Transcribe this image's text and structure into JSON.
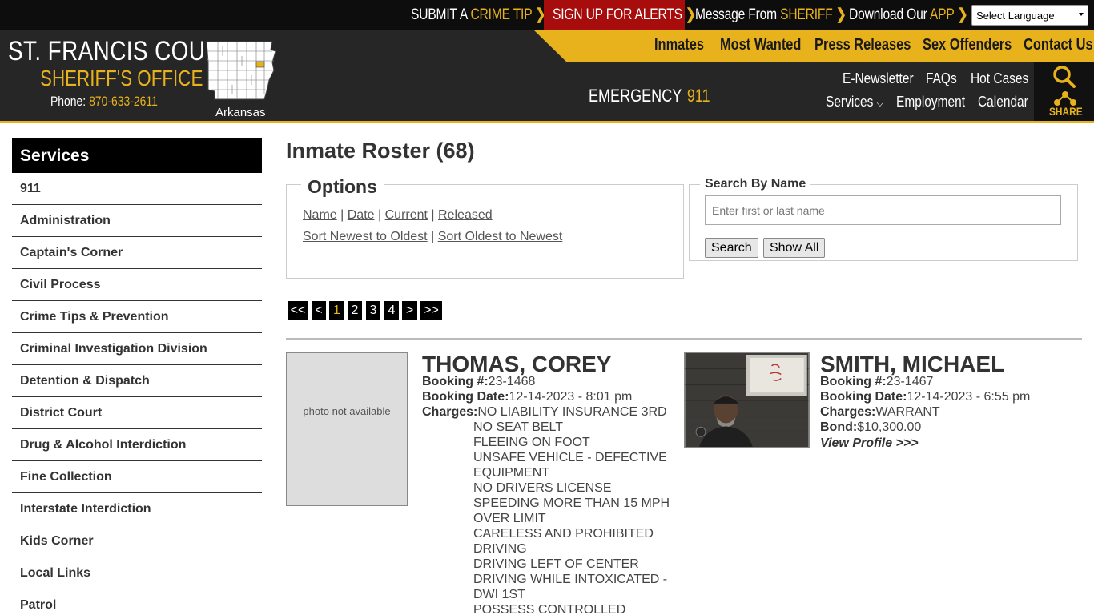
{
  "topbar": {
    "crime_tip": {
      "prefix": "SUBMIT A ",
      "highlight": "CRIME TIP"
    },
    "alerts": "SIGN UP FOR ALERTS",
    "sheriff": {
      "prefix": "Message From ",
      "highlight": "SHERIFF"
    },
    "app": {
      "prefix": "Download Our ",
      "highlight": "APP"
    },
    "language": "Select Language"
  },
  "brand": {
    "county": "ST. FRANCIS COUNTY",
    "office": "SHERIFF'S OFFICE",
    "phone_label": "Phone:",
    "phone": "870-633-2611",
    "state": "Arkansas"
  },
  "main_nav": [
    "Inmates",
    "Most Wanted",
    "Press Releases",
    "Sex Offenders",
    "Contact Us"
  ],
  "emergency": {
    "label": "EMERGENCY",
    "number": "911"
  },
  "sub_nav": {
    "enewsletter": "E-Newsletter",
    "faqs": "FAQs",
    "hot_cases": "Hot Cases",
    "services": "Services",
    "employment": "Employment",
    "calendar": "Calendar",
    "share": "SHARE"
  },
  "sidebar": {
    "title": "Services",
    "items": [
      "911",
      "Administration",
      "Captain's Corner",
      "Civil Process",
      "Crime Tips & Prevention",
      "Criminal Investigation Division",
      "Detention & Dispatch",
      "District Court",
      "Drug & Alcohol Interdiction",
      "Fine Collection",
      "Interstate Interdiction",
      "Kids Corner",
      "Local Links",
      "Patrol"
    ]
  },
  "page": {
    "title": "Inmate Roster (68)",
    "options": {
      "legend": "Options",
      "sort_name": "Name",
      "sort_date": "Date",
      "filter_current": "Current",
      "filter_released": "Released",
      "sort_newest": "Sort Newest to Oldest",
      "sort_oldest": "Sort Oldest to Newest",
      "sep": "|"
    },
    "search": {
      "legend": "Search By Name",
      "placeholder": "Enter first or last name",
      "search_btn": "Search",
      "show_all_btn": "Show All"
    },
    "pagination": {
      "first": "<<",
      "prev": "<",
      "pages": [
        "1",
        "2",
        "3",
        "4"
      ],
      "next": ">",
      "last": ">>",
      "current": "1"
    }
  },
  "inmates": [
    {
      "name": "THOMAS, COREY",
      "photo_text": "photo not available",
      "booking_label": "Booking #:",
      "booking": "23-1468",
      "date_label": "Booking Date:",
      "date": "12-14-2023 - 8:01 pm",
      "charges_label": "Charges:",
      "charges": [
        "NO LIABILITY INSURANCE 3RD",
        "NO SEAT BELT",
        "FLEEING ON FOOT",
        "UNSAFE VEHICLE - DEFECTIVE",
        "EQUIPMENT",
        "NO DRIVERS LICENSE",
        "SPEEDING MORE THAN 15 MPH",
        "OVER LIMIT",
        "CARELESS AND PROHIBITED",
        "DRIVING",
        "DRIVING LEFT OF CENTER",
        "DRIVING WHILE INTOXICATED -",
        "DWI 1ST",
        "POSSESS CONTROLLED"
      ]
    },
    {
      "name": "SMITH, MICHAEL",
      "booking_label": "Booking #:",
      "booking": "23-1467",
      "date_label": "Booking Date:",
      "date": "12-14-2023 - 6:55 pm",
      "charges_label": "Charges:",
      "charges": [
        "WARRANT"
      ],
      "bond_label": "Bond:",
      "bond": "$10,300.00",
      "profile_link": "View Profile >>>"
    }
  ],
  "colors": {
    "accent": "#e8b21c",
    "alert_red": "#a70d0d",
    "header": "#262626"
  }
}
